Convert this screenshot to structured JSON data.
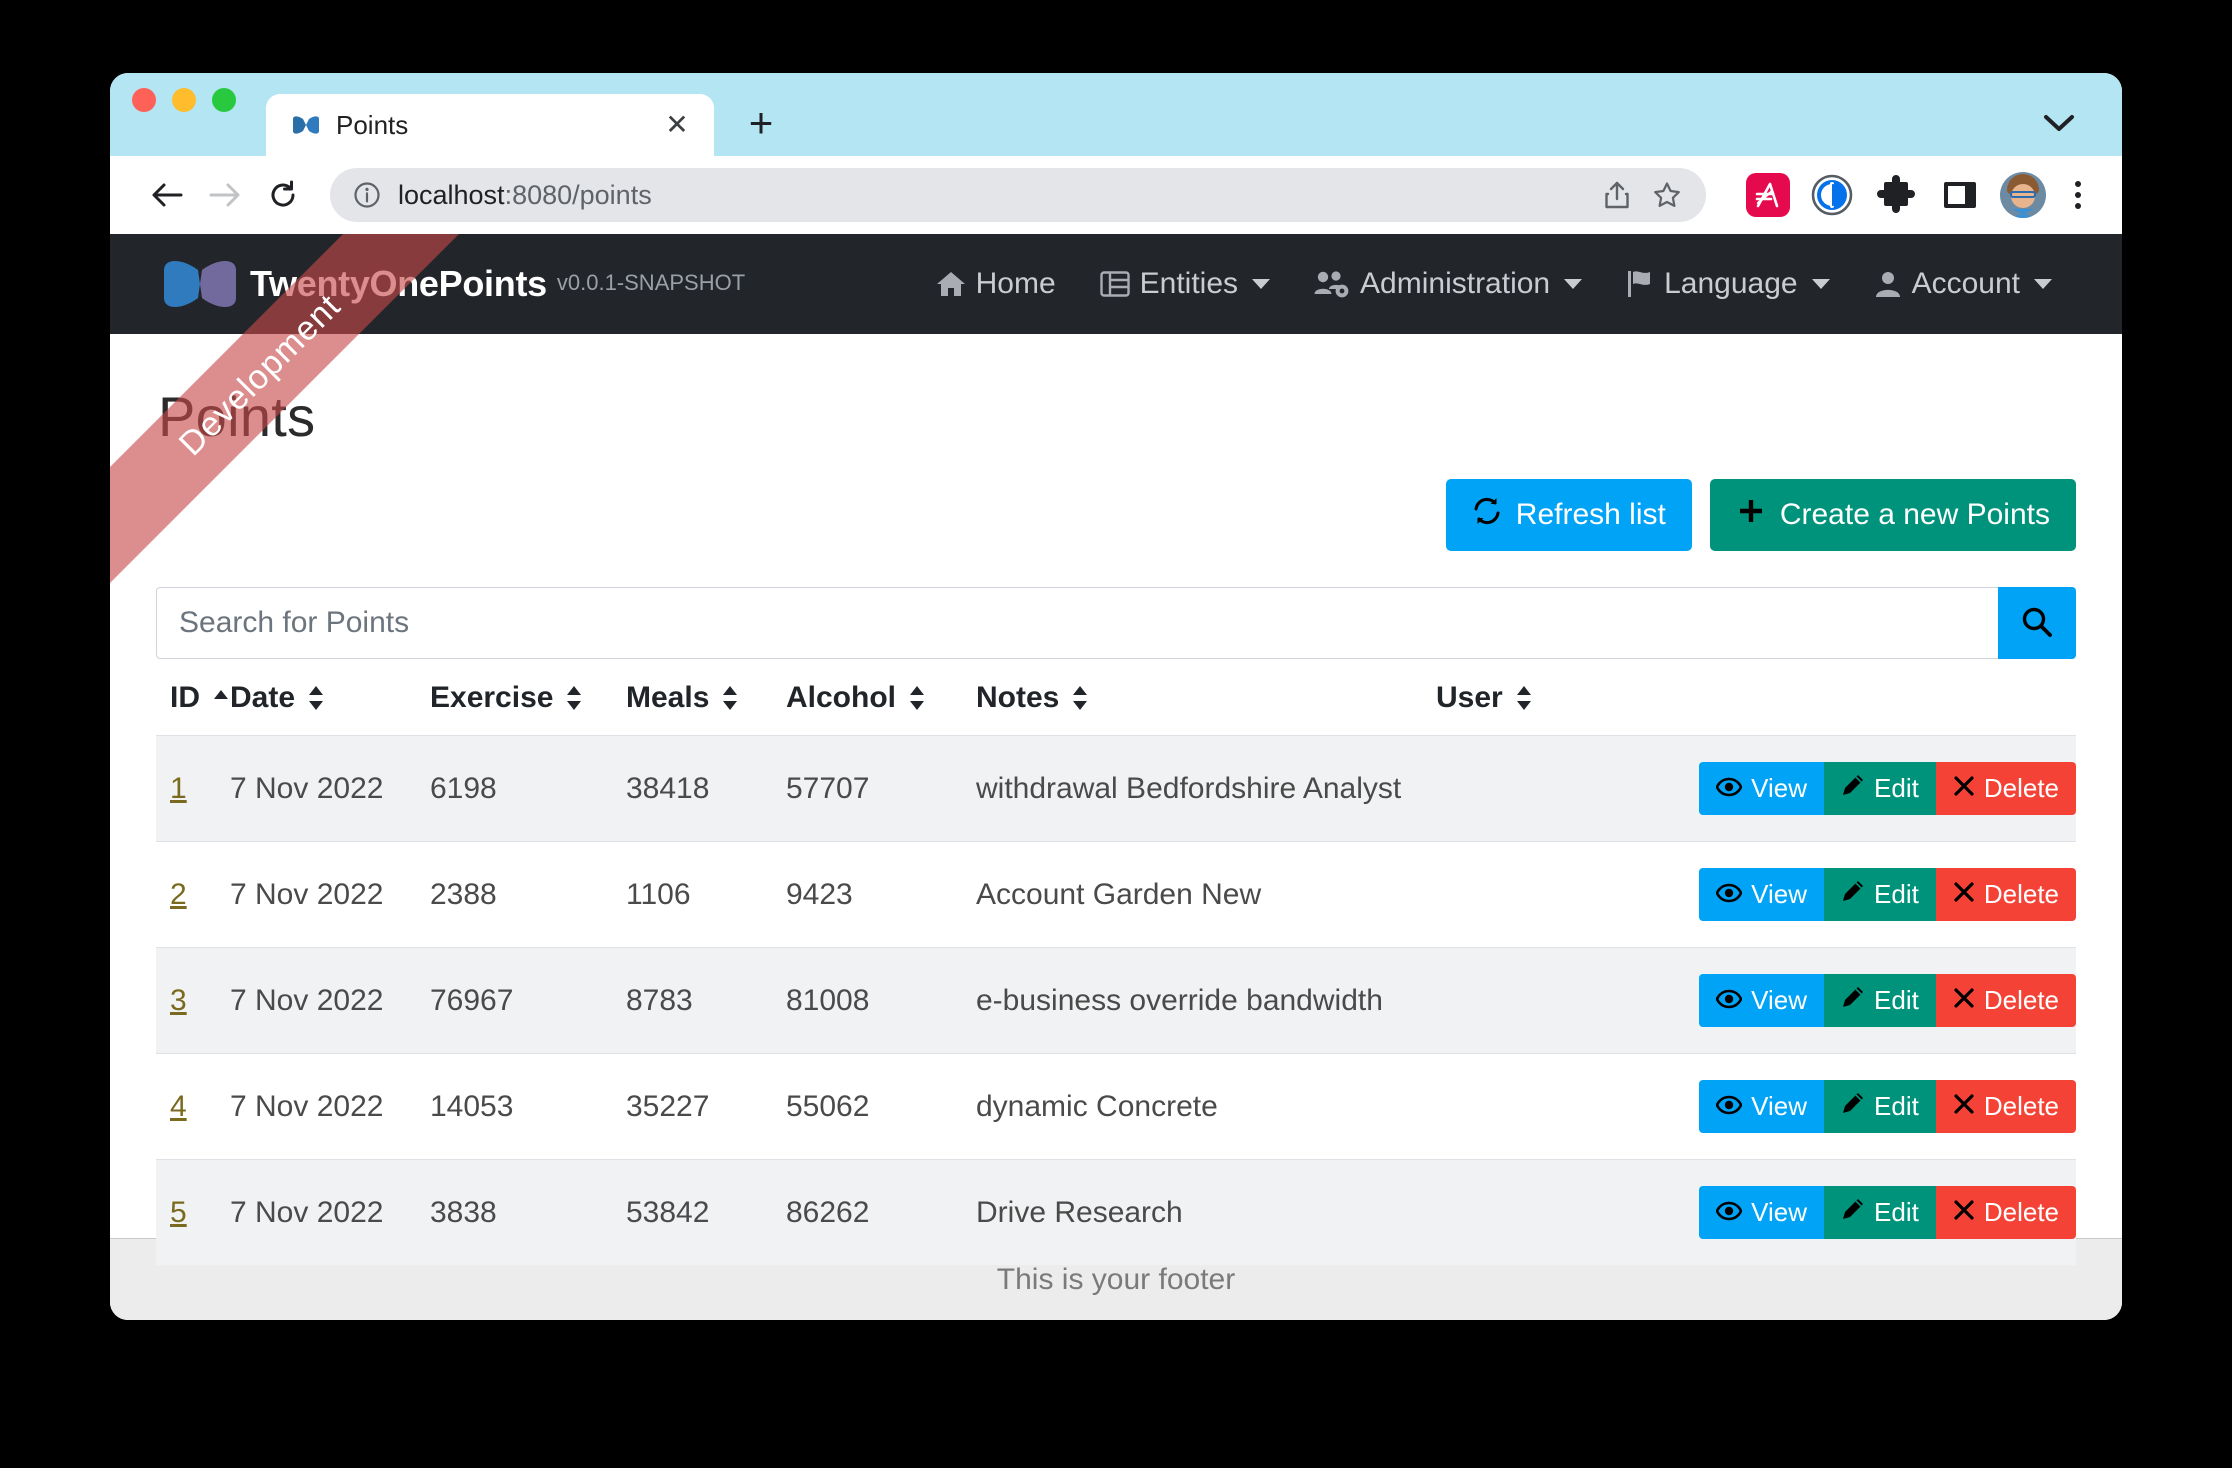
{
  "browser": {
    "tab": {
      "title": "Points",
      "favicon_icon": "bowtie-favicon",
      "close_icon": "close-icon"
    },
    "new_tab_label": "+",
    "tabstrip_chevron_icon": "chevron-down-icon",
    "toolbar": {
      "back_icon": "back-arrow-icon",
      "forward_icon": "forward-arrow-icon",
      "reload_icon": "reload-icon",
      "info_icon": "info-circle-icon",
      "url_host": "localhost",
      "url_path": ":8080/points",
      "url_full": "localhost:8080/points",
      "share_icon": "share-icon",
      "bookmark_icon": "star-icon",
      "extensions": [
        {
          "name": "arc-extension-icon",
          "color": "#e50a4e"
        },
        {
          "name": "onepassword-extension-icon",
          "color": "#0572ec"
        },
        {
          "name": "puzzle-extensions-icon",
          "color": "#202124"
        },
        {
          "name": "side-panel-icon",
          "color": "#202124"
        }
      ],
      "avatar_icon": "profile-avatar",
      "menu_icon": "kebab-menu-icon"
    }
  },
  "ribbon": {
    "label": "Development"
  },
  "navbar": {
    "brand_logo_icon": "bowtie-logo-icon",
    "brand_name": "TwentyOnePoints",
    "version": "v0.0.1-SNAPSHOT",
    "items": [
      {
        "label": "Home",
        "icon": "home-icon",
        "has_caret": false
      },
      {
        "label": "Entities",
        "icon": "list-table-icon",
        "has_caret": true
      },
      {
        "label": "Administration",
        "icon": "users-cog-icon",
        "has_caret": true
      },
      {
        "label": "Language",
        "icon": "flag-icon",
        "has_caret": true
      },
      {
        "label": "Account",
        "icon": "user-icon",
        "has_caret": true
      }
    ]
  },
  "page": {
    "title": "Points",
    "refresh_label": "Refresh list",
    "refresh_icon": "sync-icon",
    "create_label": "Create a new Points",
    "create_icon": "plus-icon",
    "accent_blue": "#00a3f5",
    "accent_green": "#00937c",
    "accent_red": "#f44336"
  },
  "search": {
    "placeholder": "Search for Points",
    "value": "",
    "button_icon": "search-icon"
  },
  "table": {
    "columns": [
      {
        "key": "id",
        "label": "ID",
        "sort": "asc"
      },
      {
        "key": "date",
        "label": "Date",
        "sort": "none"
      },
      {
        "key": "exercise",
        "label": "Exercise",
        "sort": "none"
      },
      {
        "key": "meals",
        "label": "Meals",
        "sort": "none"
      },
      {
        "key": "alcohol",
        "label": "Alcohol",
        "sort": "none"
      },
      {
        "key": "notes",
        "label": "Notes",
        "sort": "none"
      },
      {
        "key": "user",
        "label": "User",
        "sort": "none"
      }
    ],
    "row_actions": {
      "view_label": "View",
      "view_icon": "eye-icon",
      "edit_label": "Edit",
      "edit_icon": "pencil-icon",
      "delete_label": "Delete",
      "delete_icon": "times-icon"
    },
    "rows": [
      {
        "id": "1",
        "date": "7 Nov 2022",
        "exercise": "6198",
        "meals": "38418",
        "alcohol": "57707",
        "notes": "withdrawal Bedfordshire Analyst",
        "user": ""
      },
      {
        "id": "2",
        "date": "7 Nov 2022",
        "exercise": "2388",
        "meals": "1106",
        "alcohol": "9423",
        "notes": "Account Garden New",
        "user": ""
      },
      {
        "id": "3",
        "date": "7 Nov 2022",
        "exercise": "76967",
        "meals": "8783",
        "alcohol": "81008",
        "notes": "e-business override bandwidth",
        "user": ""
      },
      {
        "id": "4",
        "date": "7 Nov 2022",
        "exercise": "14053",
        "meals": "35227",
        "alcohol": "55062",
        "notes": "dynamic Concrete",
        "user": ""
      },
      {
        "id": "5",
        "date": "7 Nov 2022",
        "exercise": "3838",
        "meals": "53842",
        "alcohol": "86262",
        "notes": "Drive Research",
        "user": ""
      }
    ]
  },
  "footer": {
    "text": "This is your footer"
  }
}
